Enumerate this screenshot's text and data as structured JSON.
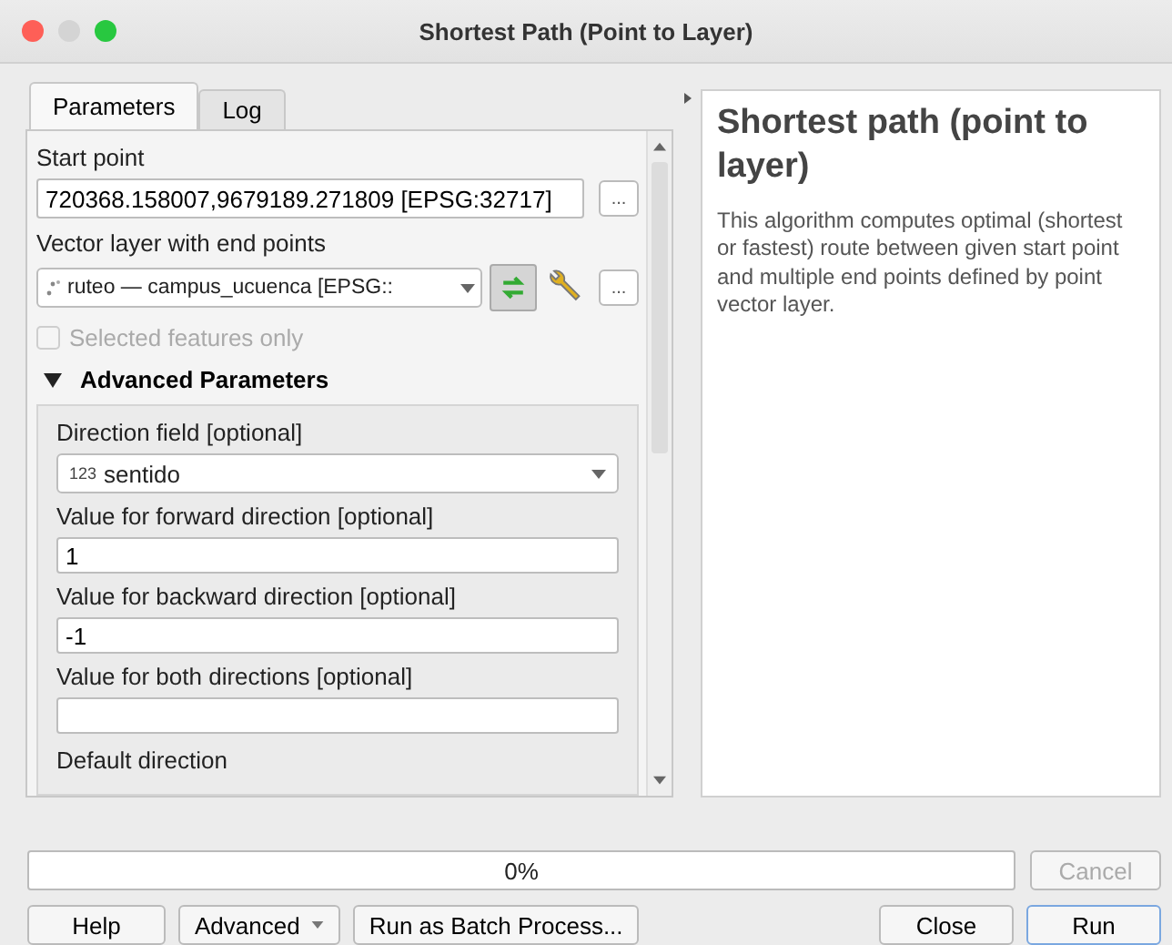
{
  "window": {
    "title": "Shortest Path (Point to Layer)"
  },
  "tabs": [
    {
      "label": "Parameters",
      "selected": true
    },
    {
      "label": "Log",
      "selected": false
    }
  ],
  "parameters": [
    {
      "kind": "point",
      "label": "Start point",
      "value": "720368.158007,9679189.271809 [EPSG:32717]",
      "button": "..."
    },
    {
      "kind": "layer",
      "label": "Vector layer with end points",
      "value": "ruteo — campus_ucuenca [EPSG::",
      "button": "..."
    },
    {
      "kind": "checkbox",
      "label": "Selected features only",
      "checked": false,
      "disabled": true
    }
  ],
  "advanced": {
    "label": "Advanced Parameters",
    "expanded": true,
    "items": [
      {
        "kind": "combo",
        "label": "Direction field [optional]",
        "type_badge": "123",
        "value": "sentido"
      },
      {
        "kind": "text",
        "label": "Value for forward direction [optional]",
        "value": "1"
      },
      {
        "kind": "text",
        "label": "Value for backward direction [optional]",
        "value": "-1"
      },
      {
        "kind": "text",
        "label": "Value for both directions [optional]",
        "value": ""
      },
      {
        "kind": "heading",
        "label": "Default direction"
      }
    ]
  },
  "help": {
    "title": "Shortest path (point to layer)",
    "text": "This algorithm computes optimal (shortest or fastest) route between given start point and multiple end points defined by point vector layer."
  },
  "progress": {
    "level": 0,
    "reading": "0%"
  },
  "cancel": {
    "label": "Cancel",
    "disabled": true
  },
  "buttons": [
    {
      "label": "Help",
      "kind": "plain"
    },
    {
      "label": "Advanced",
      "kind": "menu"
    },
    {
      "label": "Run as Batch Process...",
      "kind": "plain"
    }
  ],
  "right_buttons": [
    {
      "label": "Close",
      "default": false
    },
    {
      "label": "Run",
      "default": true
    }
  ]
}
